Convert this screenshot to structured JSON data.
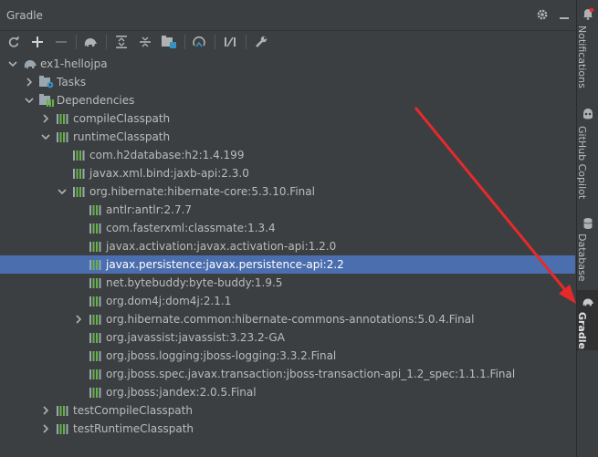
{
  "panel": {
    "title": "Gradle"
  },
  "header_icons": [
    "gear-icon",
    "minimize-icon"
  ],
  "toolbar": {
    "buttons": [
      "refresh-icon",
      "add-icon",
      "remove-icon",
      "elephant-icon",
      "expand-all-icon",
      "collapse-all-icon",
      "dependencies-icon",
      "offline-mode-icon",
      "toggle-skip-tests-icon",
      "settings-wrench-icon"
    ]
  },
  "tree": {
    "project": "ex1-hellojpa",
    "tasks": "Tasks",
    "dependencies": "Dependencies",
    "compile_classpath": "compileClasspath",
    "runtime_classpath": "runtimeClasspath",
    "dep_h2": "com.h2database:h2:1.4.199",
    "dep_jaxb": "javax.xml.bind:jaxb-api:2.3.0",
    "dep_hibernate": "org.hibernate:hibernate-core:5.3.10.Final",
    "dep_antlr": "antlr:antlr:2.7.7",
    "dep_classmate": "com.fasterxml:classmate:1.3.4",
    "dep_activation": "javax.activation:javax.activation-api:1.2.0",
    "dep_persistence": "javax.persistence:javax.persistence-api:2.2",
    "dep_bytebuddy": "net.bytebuddy:byte-buddy:1.9.5",
    "dep_dom4j": "org.dom4j:dom4j:2.1.1",
    "dep_commons_annotations": "org.hibernate.common:hibernate-commons-annotations:5.0.4.Final",
    "dep_javassist": "org.javassist:javassist:3.23.2-GA",
    "dep_jboss_logging": "org.jboss.logging:jboss-logging:3.3.2.Final",
    "dep_jboss_tx": "org.jboss.spec.javax.transaction:jboss-transaction-api_1.2_spec:1.1.1.Final",
    "dep_jandex": "org.jboss:jandex:2.0.5.Final",
    "test_compile_classpath": "testCompileClasspath",
    "test_runtime_classpath": "testRuntimeClasspath"
  },
  "right_tabs": {
    "notifications": "Notifications",
    "copilot": "GitHub Copilot",
    "database": "Database",
    "gradle": "Gradle"
  },
  "colors": {
    "background": "#3c3f41",
    "selection": "#4b6eaf",
    "text": "#bbbbbb",
    "annotation_arrow": "#e8292b"
  }
}
